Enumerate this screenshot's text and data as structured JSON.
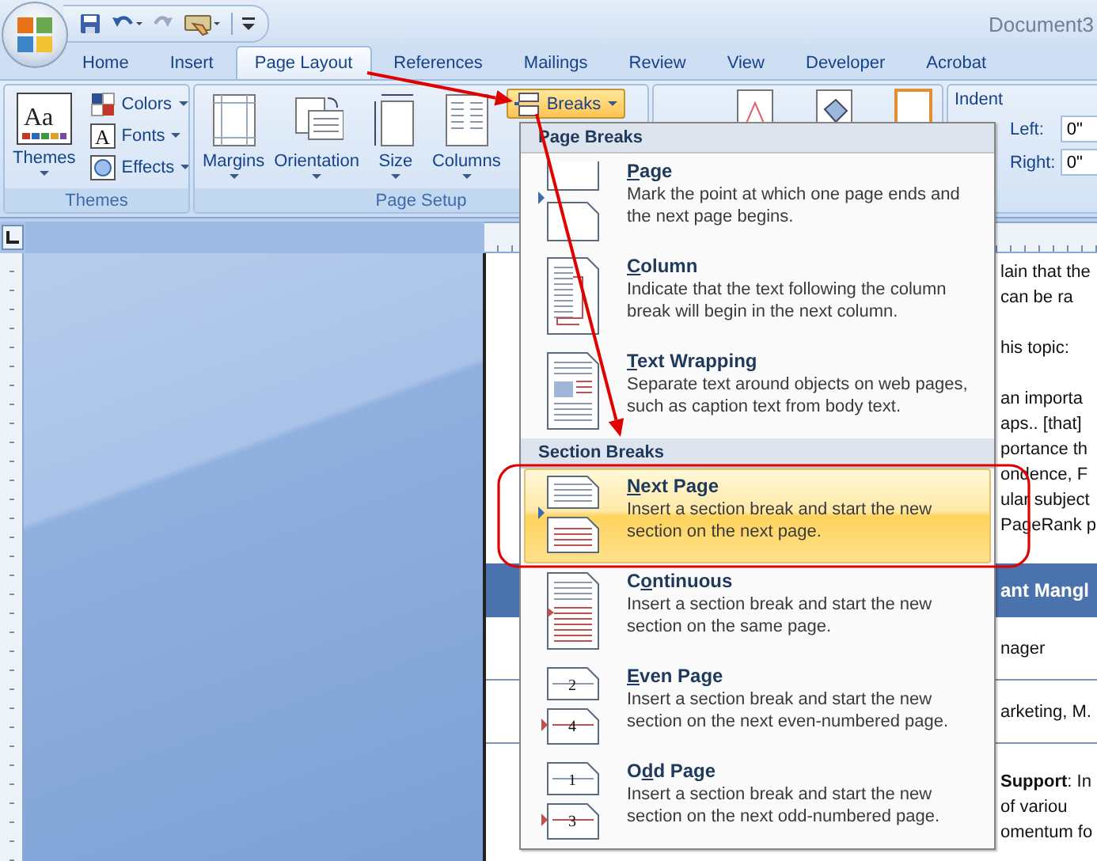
{
  "window": {
    "title": "Document3"
  },
  "tabs": [
    {
      "label": "Home",
      "selected": false
    },
    {
      "label": "Insert",
      "selected": false
    },
    {
      "label": "Page Layout",
      "selected": true
    },
    {
      "label": "References",
      "selected": false
    },
    {
      "label": "Mailings",
      "selected": false
    },
    {
      "label": "Review",
      "selected": false
    },
    {
      "label": "View",
      "selected": false
    },
    {
      "label": "Developer",
      "selected": false
    },
    {
      "label": "Acrobat",
      "selected": false
    }
  ],
  "ribbon": {
    "groups": [
      {
        "kind": "themes",
        "label": "Themes",
        "buttons": [
          {
            "kind": "large",
            "label": "Themes",
            "icon_text": "Aa"
          },
          {
            "kind": "small",
            "label": "Colors"
          },
          {
            "kind": "small",
            "label": "Fonts",
            "icon_text": "A"
          },
          {
            "kind": "small",
            "label": "Effects"
          }
        ]
      },
      {
        "kind": "page_setup",
        "label": "Page Setup",
        "buttons": [
          {
            "kind": "large",
            "label": "Margins"
          },
          {
            "kind": "large",
            "label": "Orientation"
          },
          {
            "kind": "large",
            "label": "Size"
          },
          {
            "kind": "large",
            "label": "Columns"
          },
          {
            "kind": "small",
            "label": "Breaks",
            "pressed": true
          }
        ]
      },
      {
        "kind": "icons"
      },
      {
        "kind": "indent",
        "label": "Indent",
        "fields": [
          {
            "label": "Left:",
            "value": "0\""
          },
          {
            "label": "Right:",
            "value": "0\""
          }
        ]
      }
    ]
  },
  "breaks_menu": {
    "sections": [
      {
        "header": "Page Breaks",
        "items": [
          {
            "kind": "page",
            "access_key": "P",
            "title_after": "age",
            "description": "Mark the point at which one page ends and the next page begins.",
            "selected": false
          },
          {
            "kind": "column",
            "access_key": "C",
            "title_after": "olumn",
            "description": "Indicate that the text following the column break will begin in the next column.",
            "selected": false
          },
          {
            "kind": "text_wrapping",
            "access_key": "T",
            "title_after": "ext Wrapping",
            "description": "Separate text around objects on web pages, such as caption text from body text.",
            "selected": false
          }
        ]
      },
      {
        "header": "Section Breaks",
        "items": [
          {
            "kind": "next_page",
            "access_key": "N",
            "title_after": "ext Page",
            "description": "Insert a section break and start the new section on the next page.",
            "selected": true
          },
          {
            "kind": "continuous",
            "title_before": "C",
            "access_key": "o",
            "title_after": "ntinuous",
            "description": "Insert a section break and start the new section on the same page.",
            "selected": false
          },
          {
            "kind": "numbered",
            "access_key": "E",
            "title_after": "ven Page",
            "description": "Insert a section break and start the new section on the next even-numbered page.",
            "selected": false,
            "icon_labels": [
              "2",
              "4"
            ]
          },
          {
            "kind": "numbered",
            "title_before": "O",
            "access_key": "d",
            "title_after": "d Page",
            "description": "Insert a section break and start the new section on the next odd-numbered page.",
            "selected": false,
            "icon_labels": [
              "1",
              "3"
            ]
          }
        ]
      }
    ]
  },
  "document": {
    "blocks": [
      {
        "kind": "paragraph",
        "lines": [
          "lain that the",
          "can be ra"
        ]
      },
      {
        "kind": "paragraph",
        "lines": [
          "his topic:"
        ]
      },
      {
        "kind": "paragraph",
        "lines": [
          "an importa",
          "aps.. [that]",
          "portance th",
          "ondence, F",
          "ular subject",
          "PageRank p"
        ]
      },
      {
        "kind": "heading",
        "text": "ant Mangl"
      },
      {
        "kind": "field",
        "text": "nager"
      },
      {
        "kind": "field",
        "text": "arketing, M."
      },
      {
        "kind": "paragraph",
        "lines": [
          "**Support**: In",
          "of variou",
          "omentum fo"
        ]
      }
    ]
  },
  "annotations": [
    {
      "kind": "arrow"
    },
    {
      "kind": "arrow"
    },
    {
      "kind": "outline"
    }
  ]
}
